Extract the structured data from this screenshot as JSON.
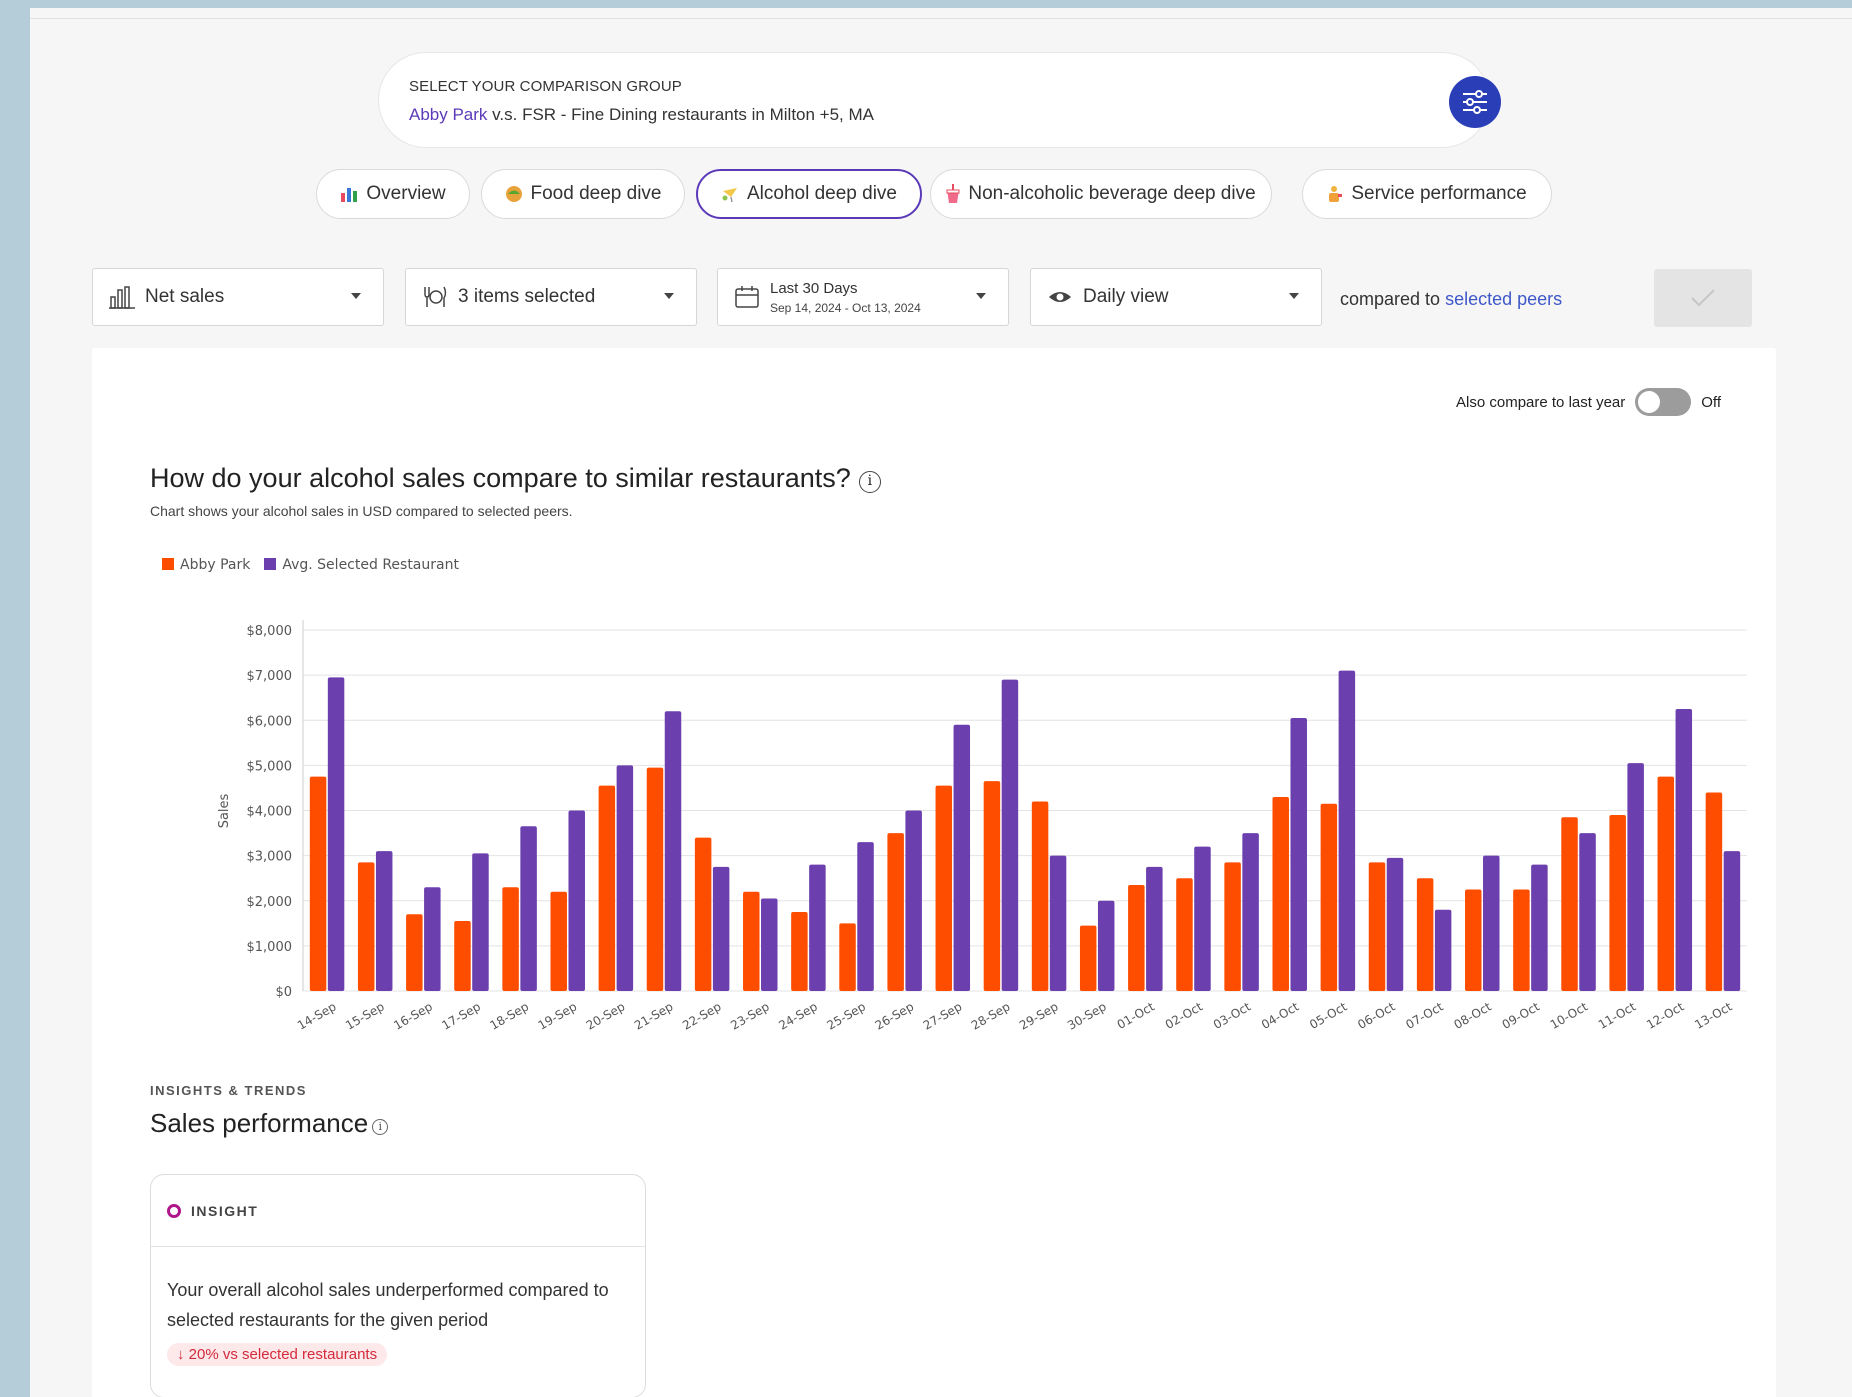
{
  "comparison": {
    "heading": "SELECT YOUR COMPARISON GROUP",
    "restaurant": "Abby Park",
    "description": " v.s. FSR - Fine Dining restaurants in Milton +5, MA"
  },
  "tabs": [
    {
      "label": "Overview",
      "icon": "bar-chart-icon"
    },
    {
      "label": "Food deep dive",
      "icon": "taco-icon"
    },
    {
      "label": "Alcohol deep dive",
      "icon": "cocktail-icon"
    },
    {
      "label": "Non-alcoholic beverage deep dive",
      "icon": "soda-cup-icon"
    },
    {
      "label": "Service performance",
      "icon": "server-icon"
    }
  ],
  "filters": {
    "metric": "Net sales",
    "items": "3 items selected",
    "date_range_label": "Last 30 Days",
    "date_range_value": "Sep 14, 2024 - Oct 13, 2024",
    "view": "Daily view",
    "compared_prefix": "compared to ",
    "compared_link": "selected peers"
  },
  "toggle": {
    "label": "Also compare to last year",
    "state": "Off"
  },
  "chart_heading": {
    "title": "How do your alcohol sales compare to similar restaurants?",
    "subtitle": "Chart shows your alcohol sales in USD compared to selected peers."
  },
  "chart_data": {
    "type": "bar",
    "title": "How do your alcohol sales compare to similar restaurants?",
    "xlabel": "",
    "ylabel": "Sales",
    "ylim": [
      0,
      8000
    ],
    "yticks": [
      "$0",
      "$1,000",
      "$2,000",
      "$3,000",
      "$4,000",
      "$5,000",
      "$6,000",
      "$7,000",
      "$8,000"
    ],
    "grid": true,
    "legend_position": "top-left",
    "categories": [
      "14-Sep",
      "15-Sep",
      "16-Sep",
      "17-Sep",
      "18-Sep",
      "19-Sep",
      "20-Sep",
      "21-Sep",
      "22-Sep",
      "23-Sep",
      "24-Sep",
      "25-Sep",
      "26-Sep",
      "27-Sep",
      "28-Sep",
      "29-Sep",
      "30-Sep",
      "01-Oct",
      "02-Oct",
      "03-Oct",
      "04-Oct",
      "05-Oct",
      "06-Oct",
      "07-Oct",
      "08-Oct",
      "09-Oct",
      "10-Oct",
      "11-Oct",
      "12-Oct",
      "13-Oct"
    ],
    "series": [
      {
        "name": "Abby Park",
        "color": "#ff4d00",
        "values": [
          4750,
          2850,
          1700,
          1550,
          2300,
          2200,
          4550,
          4950,
          3400,
          2200,
          1750,
          1500,
          3500,
          4550,
          4650,
          4200,
          1450,
          2350,
          2500,
          2850,
          4300,
          4150,
          2850,
          2500,
          2250,
          2250,
          3850,
          3900,
          4750,
          4400
        ]
      },
      {
        "name": "Avg. Selected Restaurant",
        "color": "#6b3fae",
        "values": [
          6950,
          3100,
          2300,
          3050,
          3650,
          4000,
          5000,
          6200,
          2750,
          2050,
          2800,
          3300,
          4000,
          5900,
          6900,
          3000,
          2000,
          2750,
          3200,
          3500,
          6050,
          7100,
          2950,
          1800,
          3000,
          2800,
          3500,
          5050,
          6250,
          3100
        ]
      }
    ]
  },
  "insights": {
    "section_label": "INSIGHTS & TRENDS",
    "section_title": "Sales performance",
    "card_label": "INSIGHT",
    "text": "Your overall alcohol sales underperformed compared to selected restaurants for the given period",
    "badge": "↓ 20% vs selected restaurants"
  },
  "colors": {
    "accent": "#5b3ab8",
    "brand_button": "#2a3fb7",
    "bar_primary": "#ff4d00",
    "bar_peer": "#6b3fae",
    "negative": "#d42a3c"
  }
}
